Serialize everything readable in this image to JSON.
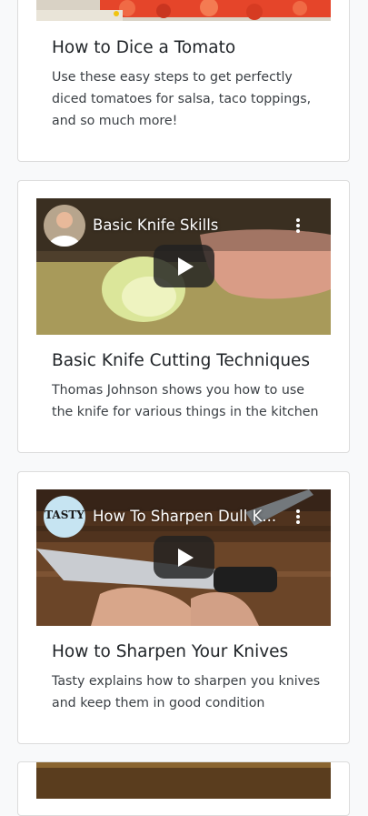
{
  "cards": [
    {
      "title": "How to Dice a Tomato",
      "description": "Use these easy steps to get perfectly diced tomatoes for salsa, taco toppings, and so much more!"
    },
    {
      "title": "Basic Knife Cutting Techniques",
      "description": "Thomas Johnson shows you how to use the knife for various things in the kitchen",
      "video": {
        "title": "Basic Knife Skills",
        "channel_icon": "chef-avatar-icon"
      }
    },
    {
      "title": "How to Sharpen Your Knives",
      "description": "Tasty explains how to sharpen you knives and keep them in good condition",
      "video": {
        "title": "How To Sharpen Dull K...",
        "channel_icon": "tasty-logo-icon",
        "channel_logo_text": "TASTY"
      }
    }
  ],
  "colors": {
    "page_bg": "#f8f9fa",
    "card_bg": "#ffffff",
    "title_text": "#212529",
    "body_text": "#3a3f44"
  }
}
